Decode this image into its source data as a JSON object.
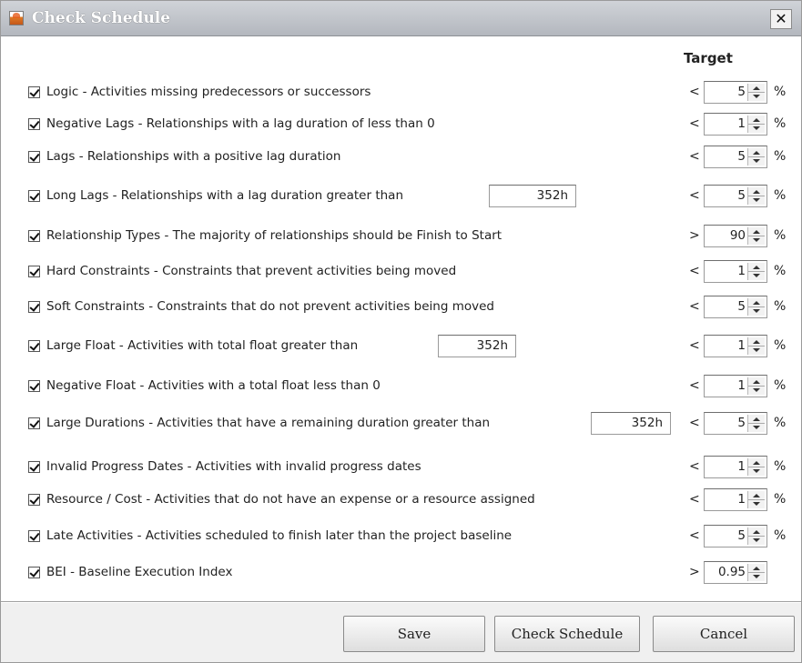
{
  "window": {
    "title": "Check Schedule",
    "close_label": "✕"
  },
  "target_header": "Target",
  "rows": [
    {
      "label": "Logic - Activities missing predecessors or successors",
      "checked": true,
      "operator": "<",
      "target": "5",
      "unit": "%"
    },
    {
      "label": "Negative Lags - Relationships with a lag duration of less than 0",
      "checked": true,
      "operator": "<",
      "target": "1",
      "unit": "%"
    },
    {
      "label": "Lags - Relationships with a positive lag duration",
      "checked": true,
      "operator": "<",
      "target": "5",
      "unit": "%"
    },
    {
      "label": "Long Lags - Relationships with a lag duration greater than",
      "checked": true,
      "threshold": "352h",
      "operator": "<",
      "target": "5",
      "unit": "%"
    },
    {
      "label": "Relationship Types - The majority of relationships should be Finish to Start",
      "checked": true,
      "operator": ">",
      "target": "90",
      "unit": "%"
    },
    {
      "label": "Hard Constraints - Constraints that prevent activities being moved",
      "checked": true,
      "operator": "<",
      "target": "1",
      "unit": "%"
    },
    {
      "label": "Soft Constraints - Constraints that do not prevent activities being moved",
      "checked": true,
      "operator": "<",
      "target": "5",
      "unit": "%"
    },
    {
      "label": "Large Float - Activities with total float greater than",
      "checked": true,
      "threshold": "352h",
      "operator": "<",
      "target": "1",
      "unit": "%"
    },
    {
      "label": "Negative Float - Activities with a total float less than 0",
      "checked": true,
      "operator": "<",
      "target": "1",
      "unit": "%"
    },
    {
      "label": "Large Durations - Activities that have a remaining duration greater than",
      "checked": true,
      "threshold": "352h",
      "operator": "<",
      "target": "5",
      "unit": "%"
    },
    {
      "label": "Invalid Progress Dates - Activities with invalid progress dates",
      "checked": true,
      "operator": "<",
      "target": "1",
      "unit": "%"
    },
    {
      "label": "Resource / Cost - Activities that do not have an expense or a resource assigned",
      "checked": true,
      "operator": "<",
      "target": "1",
      "unit": "%"
    },
    {
      "label": "Late Activities - Activities scheduled to finish later than the project baseline",
      "checked": true,
      "operator": "<",
      "target": "5",
      "unit": "%"
    },
    {
      "label": "BEI - Baseline Execution Index",
      "checked": true,
      "operator": ">",
      "target": "0.95",
      "unit": ""
    }
  ],
  "buttons": {
    "save": "Save",
    "check_schedule": "Check Schedule",
    "cancel": "Cancel"
  },
  "colors": {
    "titlebar": "#b8bcc2",
    "footer": "#f0f0f0"
  }
}
